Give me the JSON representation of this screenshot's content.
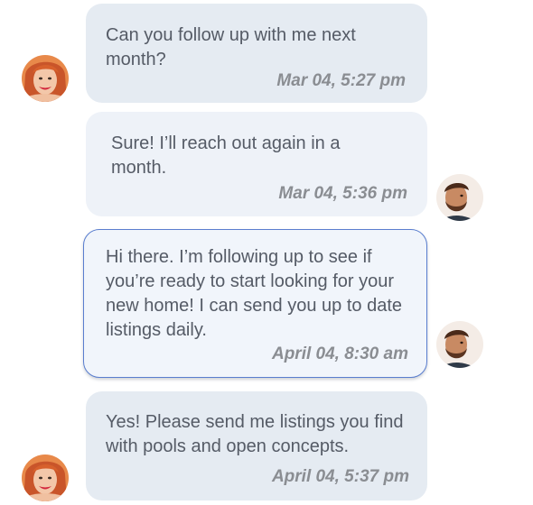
{
  "messages": [
    {
      "sender": "client",
      "text": "Can you follow up with me next month?",
      "time": "Mar 04, 5:27 pm"
    },
    {
      "sender": "agent",
      "text": "Sure! I’ll reach out again in a month.",
      "time": "Mar 04, 5:36 pm"
    },
    {
      "sender": "agent",
      "text": "Hi there. I’m following up to see if you’re ready to start looking for your new home! I can send you up to date listings daily.",
      "time": "April 04, 8:30 am"
    },
    {
      "sender": "client",
      "text": "Yes! Please send me listings you find with pools and open concepts.",
      "time": "April 04, 5:37 pm"
    }
  ],
  "colors": {
    "incoming_bubble": "#e5ebf2",
    "outgoing_bubble": "#eef2f8",
    "highlight_border": "#5a7ecf",
    "message_text": "#555b66",
    "timestamp_text": "#8a8d92"
  }
}
